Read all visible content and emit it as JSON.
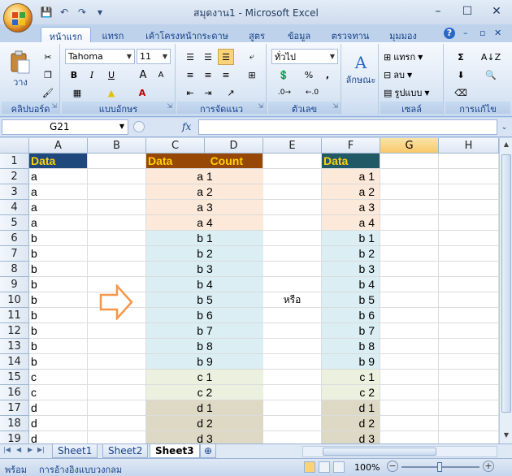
{
  "window": {
    "title": "สมุดงาน1 - Microsoft Excel",
    "minimize": "–",
    "maximize": "☐",
    "close": "✕",
    "help": "?",
    "rib_min": "–",
    "rib_restore": "▫",
    "rib_close": "✕"
  },
  "qat": {
    "save": "💾",
    "undo": "↶",
    "redo": "↷",
    "more": "▾"
  },
  "tabs": [
    "หน้าแรก",
    "แทรก",
    "เค้าโครงหน้ากระดาษ",
    "สูตร",
    "ข้อมูล",
    "ตรวจทาน",
    "มุมมอง"
  ],
  "ribbon": {
    "clipboard": {
      "label": "คลิปบอร์ด",
      "paste": "วาง"
    },
    "font": {
      "label": "แบบอักษร",
      "name": "Tahoma",
      "size": "11",
      "bold": "B",
      "italic": "I",
      "underline": "U",
      "grow": "A",
      "shrink": "A"
    },
    "alignment": {
      "label": "การจัดแนว"
    },
    "number": {
      "label": "ตัวเลข",
      "format": "ทั่วไป",
      "percent": "%",
      "comma": ","
    },
    "styles": {
      "label": "ลักษณะ"
    },
    "cells": {
      "label": "เซลล์",
      "insert": "แทรก",
      "delete": "ลบ",
      "format": "รูปแบบ"
    },
    "editing": {
      "label": "การแก้ไข",
      "sum": "Σ"
    }
  },
  "formula": {
    "namebox": "G21",
    "fx": "fx",
    "content": ""
  },
  "columns": [
    "A",
    "B",
    "C",
    "D",
    "E",
    "F",
    "G",
    "H"
  ],
  "rows": [
    "1",
    "2",
    "3",
    "4",
    "5",
    "6",
    "7",
    "8",
    "9",
    "10",
    "11",
    "12",
    "13",
    "14",
    "15",
    "16",
    "17",
    "18",
    "19"
  ],
  "cells": {
    "A1": "Data",
    "C1": "Data",
    "D1": "Count",
    "F1": "Data",
    "colA": [
      "a",
      "a",
      "a",
      "a",
      "b",
      "b",
      "b",
      "b",
      "b",
      "b",
      "b",
      "b",
      "b",
      "c",
      "c",
      "d",
      "d",
      "d"
    ],
    "colCD": [
      "a 1",
      "a 2",
      "a 3",
      "a 4",
      "b 1",
      "b 2",
      "b 3",
      "b 4",
      "b 5",
      "b 6",
      "b 7",
      "b 8",
      "b 9",
      "c 1",
      "c 2",
      "d 1",
      "d 2",
      "d 3"
    ],
    "colF": [
      "a 1",
      "a 2",
      "a 3",
      "a 4",
      "b 1",
      "b 2",
      "b 3",
      "b 4",
      "b 5",
      "b 6",
      "b 7",
      "b 8",
      "b 9",
      "c 1",
      "c 2",
      "d 1",
      "d 2",
      "d 3"
    ],
    "E10": "หรือ"
  },
  "colors": {
    "headerA": "#1f497d",
    "headerC": "#974706",
    "headerF": "#215967",
    "groupA": "#fde9d9",
    "groupB": "#daeef3",
    "groupC": "#ebf1de",
    "groupD": "#ddd9c4",
    "arrow": "#f79646"
  },
  "sheets": [
    "Sheet1",
    "Sheet2",
    "Sheet3"
  ],
  "status": {
    "ready": "พร้อม",
    "circular": "การอ้างอิงแบบวงกลม",
    "zoom": "100%"
  }
}
